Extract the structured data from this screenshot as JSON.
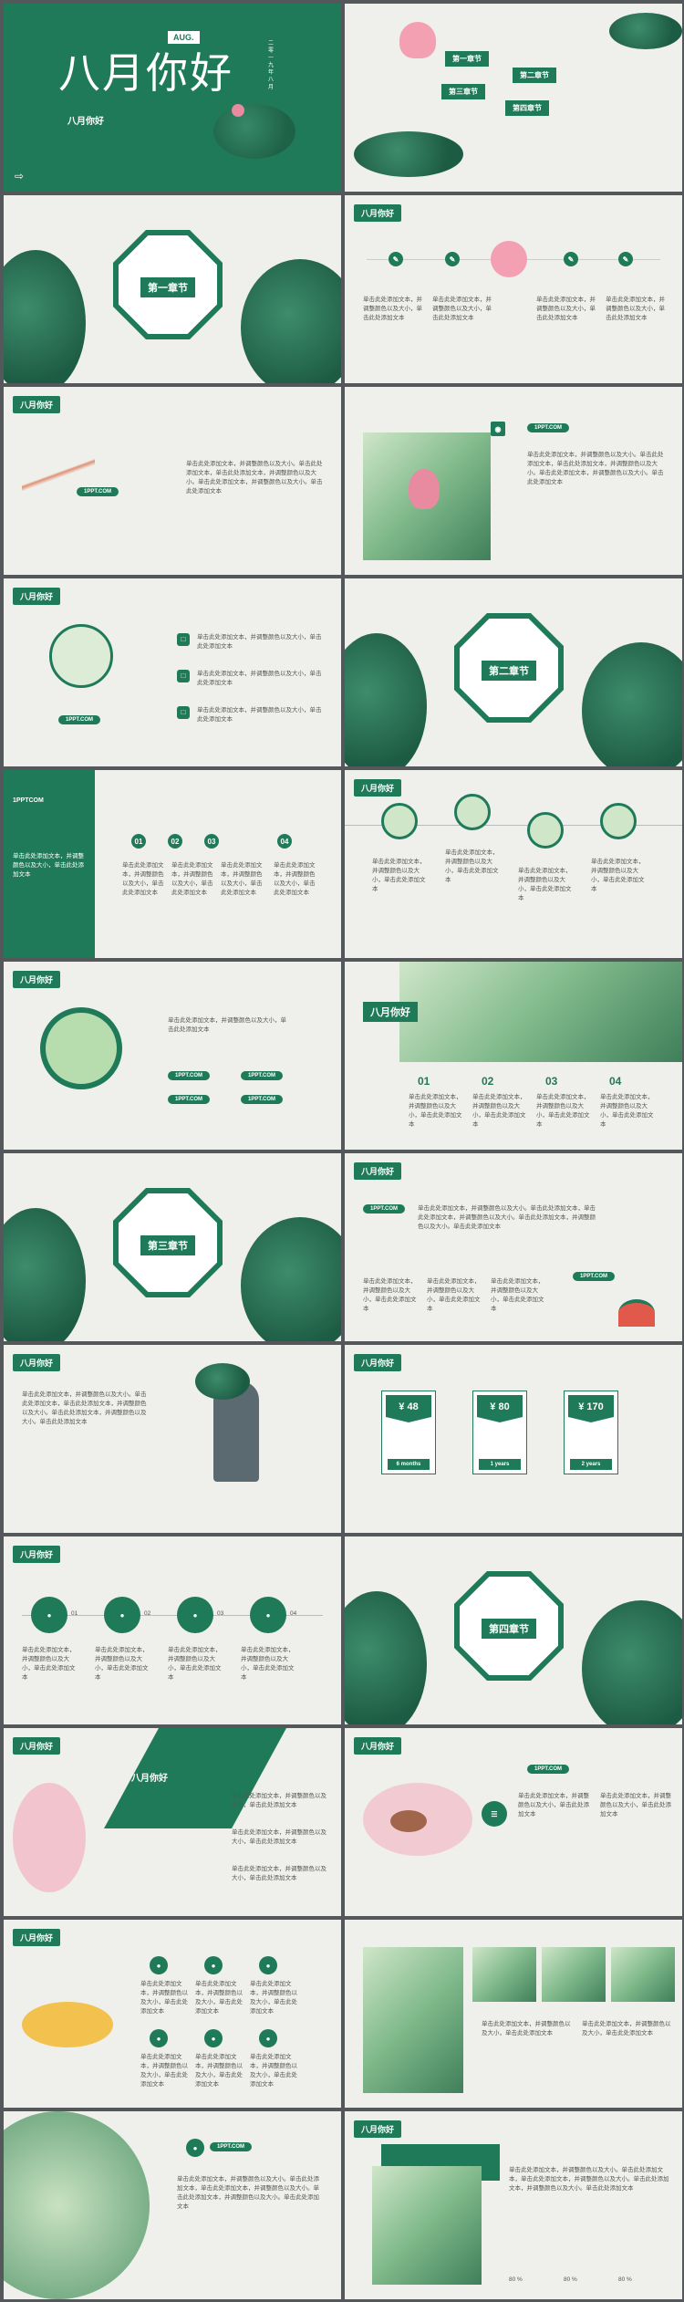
{
  "brand": "八月你好",
  "cover": {
    "title": "八月你好",
    "month": "AUG.",
    "subtitle": "八月你好",
    "vertical_note": "二零一九年八月"
  },
  "sections": [
    "第一章节",
    "第二章节",
    "第三章节",
    "第四章节"
  ],
  "url": "1PPT.COM",
  "url_variant": "1PPTCOM",
  "placeholder": "单击此处添加文本",
  "long_text": "单击此处添加文本，并调整颜色以及大小。单击此处添加文本，单击此处添加文本，并调整颜色以及大小。单击此处添加文本，并调整颜色以及大小。单击此处添加文本",
  "short_text": "单击此处添加文本，并调整颜色以及大小，单击此处添加文本",
  "numbers": [
    "01",
    "02",
    "03",
    "04"
  ],
  "prices": [
    {
      "price": "¥ 48",
      "period": "6 months"
    },
    {
      "price": "¥ 80",
      "period": "1 years"
    },
    {
      "price": "¥ 170",
      "period": "2 years"
    }
  ],
  "percents": [
    "80 %",
    "80 %",
    "80 %"
  ],
  "colors": {
    "accent": "#1f7a5a",
    "background": "#efefec",
    "page": "#55585a"
  }
}
